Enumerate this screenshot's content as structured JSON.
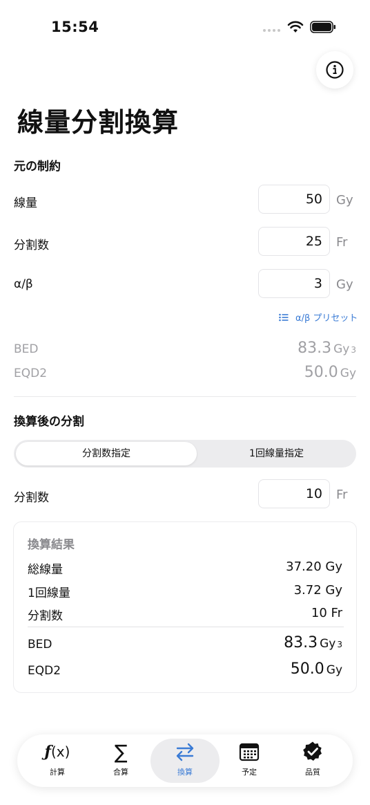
{
  "status_bar": {
    "time": "15:54"
  },
  "title": "線量分割換算",
  "original": {
    "section_title": "元の制約",
    "dose": {
      "label": "線量",
      "value": "50",
      "unit": "Gy"
    },
    "fractions": {
      "label": "分割数",
      "value": "25",
      "unit": "Fr"
    },
    "alpha_beta": {
      "label": "α/β",
      "value": "3",
      "unit": "Gy"
    },
    "preset_label": "α/β プリセット",
    "bed": {
      "label": "BED",
      "value": "83.3",
      "unit": "Gy",
      "sub": "3"
    },
    "eqd2": {
      "label": "EQD2",
      "value": "50.0",
      "unit": "Gy"
    }
  },
  "converted": {
    "section_title": "換算後の分割",
    "segments": [
      "分割数指定",
      "1回線量指定"
    ],
    "selected_segment": "分割数指定",
    "fractions": {
      "label": "分割数",
      "value": "10",
      "unit": "Fr"
    }
  },
  "result": {
    "title": "換算結果",
    "rows": [
      {
        "label": "総線量",
        "value": "37.20 Gy"
      },
      {
        "label": "1回線量",
        "value": "3.72 Gy"
      },
      {
        "label": "分割数",
        "value": "10 Fr"
      }
    ],
    "bed": {
      "label": "BED",
      "value": "83.3",
      "unit": "Gy",
      "sub": "3"
    },
    "eqd2": {
      "label": "EQD2",
      "value": "50.0",
      "unit": "Gy"
    }
  },
  "tabs": [
    {
      "label": "計算",
      "icon": "function-icon"
    },
    {
      "label": "合算",
      "icon": "sigma-icon"
    },
    {
      "label": "換算",
      "icon": "swap-arrows-icon"
    },
    {
      "label": "予定",
      "icon": "calendar-icon"
    },
    {
      "label": "品質",
      "icon": "checkmark-seal-icon"
    }
  ],
  "active_tab": "換算",
  "colors": {
    "accent": "#3a7bd5",
    "muted": "#a0a0a4",
    "background": "#ffffff"
  }
}
